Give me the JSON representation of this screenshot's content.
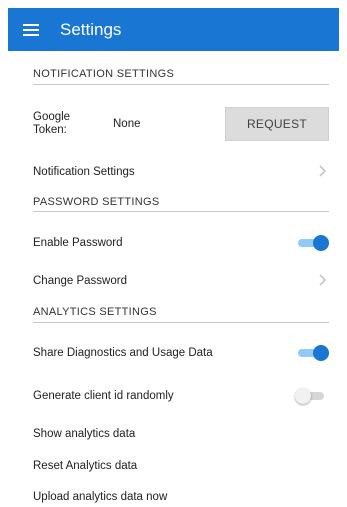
{
  "appbar": {
    "menu_icon": "hamburger-menu-icon",
    "title": "Settings",
    "color": "#1976d2"
  },
  "notification": {
    "header": "NOTIFICATION SETTINGS",
    "google_token_label": "Google Token:",
    "google_token_value": "None",
    "request_button": "REQUEST",
    "notification_settings_label": "Notification Settings"
  },
  "password": {
    "header": "PASSWORD SETTINGS",
    "enable_label": "Enable Password",
    "enable_on": true,
    "change_label": "Change Password"
  },
  "analytics": {
    "header": "ANALYTICS SETTINGS",
    "share_label": "Share Diagnostics and Usage Data",
    "share_on": true,
    "random_id_label": "Generate client id randomly",
    "random_id_on": false,
    "show_label": "Show analytics data",
    "reset_label": "Reset Analytics data",
    "upload_label": "Upload analytics data now"
  },
  "icons": {
    "chevron": "chevron-right-icon"
  }
}
